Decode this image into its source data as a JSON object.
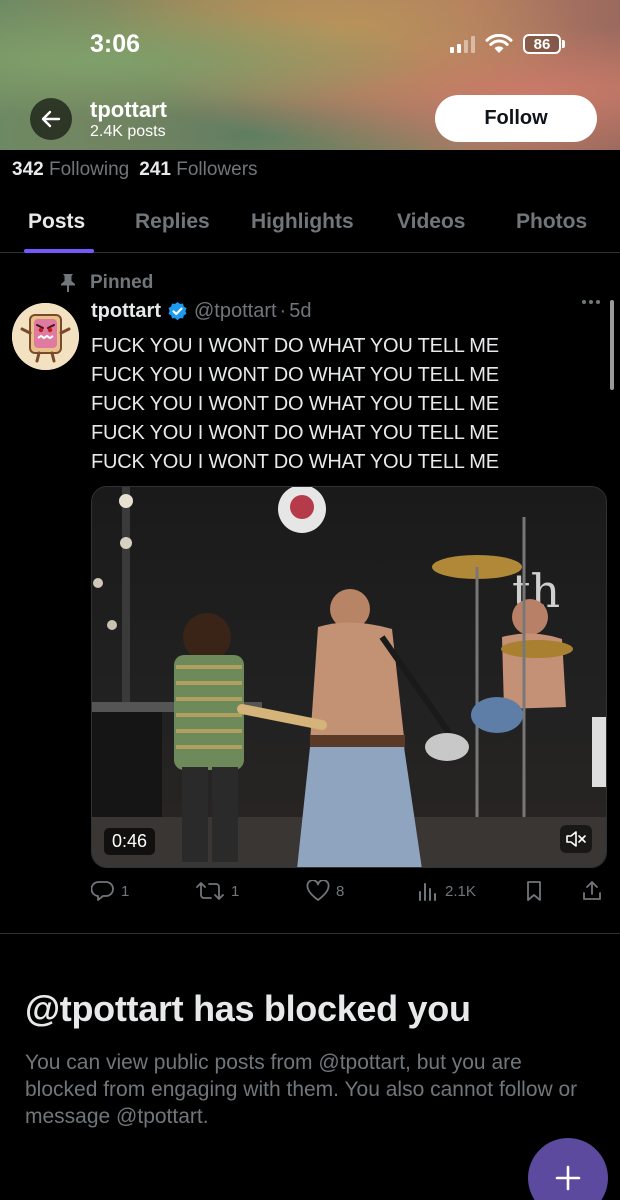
{
  "status_bar": {
    "time": "3:06",
    "battery": "86"
  },
  "profile": {
    "name": "tpottart",
    "posts_count": "2.4K posts",
    "follow_label": "Follow",
    "following_count": "342",
    "following_label": "Following",
    "followers_count": "241",
    "followers_label": "Followers"
  },
  "tabs": [
    {
      "label": "Posts",
      "active": true
    },
    {
      "label": "Replies",
      "active": false
    },
    {
      "label": "Highlights",
      "active": false
    },
    {
      "label": "Videos",
      "active": false
    },
    {
      "label": "Photos",
      "active": false
    }
  ],
  "post": {
    "pinned_label": "Pinned",
    "author_name": "tpottart",
    "author_handle": "@tpottart",
    "separator": "·",
    "time_ago": "5d",
    "text_lines": [
      "FUCK YOU I WONT DO WHAT YOU TELL ME",
      "FUCK YOU I WONT DO WHAT YOU TELL ME",
      "FUCK YOU I WONT DO WHAT YOU TELL ME",
      "FUCK YOU I WONT DO WHAT YOU TELL ME",
      "FUCK YOU I WONT DO WHAT YOU TELL ME"
    ],
    "video_duration": "0:46",
    "actions": {
      "replies": "1",
      "reposts": "1",
      "likes": "8",
      "views": "2.1K"
    }
  },
  "blocked": {
    "title": "@tpottart has blocked you",
    "description": "You can view public posts from @tpottart, but you are blocked from engaging with them. You also cannot follow or message @tpottart."
  },
  "icons": {
    "back": "arrow-left-icon",
    "verified": "verified-badge-icon",
    "pin": "pin-icon",
    "more": "more-dots-icon",
    "reply": "reply-icon",
    "repost": "repost-icon",
    "like": "heart-icon",
    "views": "analytics-icon",
    "bookmark": "bookmark-icon",
    "share": "share-icon",
    "mute": "mute-icon",
    "compose": "plus-icon"
  },
  "colors": {
    "accent": "#7856ff",
    "verified": "#1d9bf0",
    "muted_text": "#71767b",
    "fab": "#5b4a9e"
  }
}
